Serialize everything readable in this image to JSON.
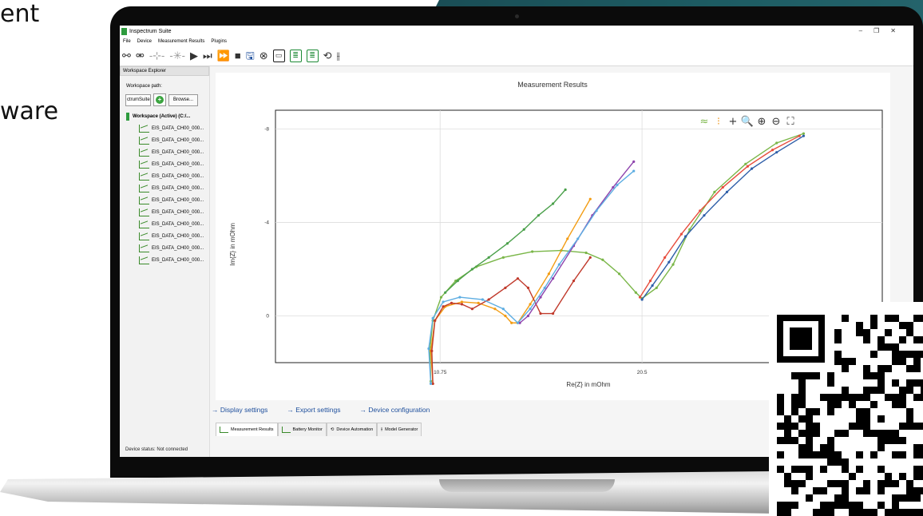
{
  "background": {
    "left_text_1": "ent",
    "left_text_2": "ware"
  },
  "app": {
    "title": "Inspectrum Suite",
    "window_controls": [
      "–",
      "❐",
      "✕"
    ],
    "menu": [
      "File",
      "Device",
      "Measurement Results",
      "Plugins"
    ]
  },
  "toolbar": {
    "icons": [
      "connect-icon",
      "disconnect-icon",
      "probe-icon",
      "probe-multi-icon",
      "play-icon",
      "skip-icon",
      "fast-forward-icon",
      "stop-icon",
      "save-icon",
      "cancel-icon",
      "device-icon",
      "sequence-icon",
      "sequence-edit-icon",
      "automation-icon",
      "circuit-icon"
    ]
  },
  "sidebar": {
    "tab_label": "Workspace Explorer",
    "path_label": "Workspace path:",
    "path_value": "ctrumSuite",
    "browse_label": "Browse...",
    "root_label": "Workspace (Active) (C:/...",
    "items": [
      "EIS_DATA_CH00_000...",
      "EIS_DATA_CH00_000...",
      "EIS_DATA_CH00_000...",
      "EIS_DATA_CH00_000...",
      "EIS_DATA_CH00_000...",
      "EIS_DATA_CH00_000...",
      "EIS_DATA_CH00_000...",
      "EIS_DATA_CH00_000...",
      "EIS_DATA_CH00_000...",
      "EIS_DATA_CH00_000...",
      "EIS_DATA_CH00_000...",
      "EIS_DATA_CH00_000..."
    ]
  },
  "links": [
    "→  Display settings",
    "→  Export settings",
    "→  Device configuration"
  ],
  "bottom_tabs": [
    "Measurement Results",
    "Battery Monitor",
    "Device Automation",
    "Model Generator"
  ],
  "status": {
    "label": "Device status:",
    "value": "Not connected"
  },
  "chart_data": {
    "type": "line",
    "title": "Measurement Results",
    "xlabel": "Re{Z} in mOhm",
    "ylabel": "Im{Z} in mOhm",
    "x_ticks": [
      10.75,
      20.5
    ],
    "y_ticks": [
      -8,
      -4,
      0
    ],
    "xlim": [
      2.8,
      32.1
    ],
    "ylim": [
      2.0,
      -8.8
    ],
    "y_inverted": true,
    "grid": true,
    "chart_tools": [
      "series-style-icon",
      "legend-icon",
      "crosshair-icon",
      "zoom-icon",
      "zoom-in-icon",
      "zoom-out-icon",
      "fit-icon"
    ],
    "series": [
      {
        "color": "#7ab648",
        "x": [
          10.3,
          10.25,
          10.4,
          10.8,
          11.5,
          12.5,
          13.8,
          15.2,
          16.6,
          17.8,
          18.6,
          19.4,
          20.2,
          20.5,
          21.2,
          22.0,
          22.8,
          24.0,
          25.5,
          27.0,
          28.3
        ],
        "y": [
          2.8,
          1.5,
          0.2,
          -0.8,
          -1.5,
          -2.1,
          -2.5,
          -2.75,
          -2.8,
          -2.7,
          -2.4,
          -1.8,
          -1.0,
          -0.75,
          -1.2,
          -2.2,
          -3.7,
          -5.3,
          -6.5,
          -7.4,
          -7.8
        ]
      },
      {
        "color": "#f39c12",
        "x": [
          10.4,
          10.3,
          10.5,
          11.0,
          11.8,
          12.6,
          13.4,
          13.9,
          14.2,
          14.5,
          15.1,
          16.0,
          16.9,
          18.0
        ],
        "y": [
          2.9,
          1.5,
          0.2,
          -0.4,
          -0.6,
          -0.55,
          -0.3,
          0.0,
          0.3,
          0.3,
          -0.5,
          -1.8,
          -3.3,
          -5.0
        ]
      },
      {
        "color": "#c0392b",
        "x": [
          10.4,
          10.35,
          10.5,
          10.9,
          11.3,
          11.8,
          12.3,
          13.1,
          13.9,
          14.5,
          15.0,
          15.6,
          16.2,
          17.2,
          18.0
        ],
        "y": [
          2.9,
          1.5,
          0.2,
          -0.4,
          -0.55,
          -0.5,
          -0.3,
          -0.7,
          -1.2,
          -1.6,
          -1.2,
          -0.1,
          -0.1,
          -1.5,
          -2.5
        ]
      },
      {
        "color": "#8e44ad",
        "x": [
          14.6,
          15.0,
          15.6,
          16.2,
          17.2,
          18.1,
          19.1,
          20.1
        ],
        "y": [
          0.3,
          0.0,
          -0.8,
          -1.6,
          -3.0,
          -4.3,
          -5.5,
          -6.6
        ]
      },
      {
        "color": "#5dade2",
        "x": [
          10.3,
          10.2,
          10.4,
          10.9,
          11.7,
          12.8,
          13.8,
          14.5,
          15.1,
          15.8,
          16.5,
          17.4,
          18.3,
          19.3,
          20.1
        ],
        "y": [
          2.9,
          1.4,
          0.1,
          -0.6,
          -0.8,
          -0.7,
          -0.3,
          0.3,
          -0.3,
          -1.2,
          -2.2,
          -3.3,
          -4.5,
          -5.6,
          -6.2
        ]
      },
      {
        "color": "#4aa04a",
        "x": [
          11.0,
          11.6,
          12.3,
          13.1,
          14.0,
          14.8,
          15.5,
          16.2,
          16.8
        ],
        "y": [
          -1.0,
          -1.5,
          -2.0,
          -2.5,
          -3.1,
          -3.7,
          -4.3,
          -4.8,
          -5.4
        ]
      },
      {
        "color": "#e74c3c",
        "x": [
          20.4,
          20.9,
          21.6,
          22.4,
          23.3,
          24.4,
          25.6,
          26.8,
          28.1
        ],
        "y": [
          -0.8,
          -1.5,
          -2.5,
          -3.5,
          -4.5,
          -5.5,
          -6.4,
          -7.1,
          -7.7
        ]
      },
      {
        "color": "#2e5ea8",
        "x": [
          20.5,
          21.0,
          21.8,
          22.6,
          23.5,
          24.6,
          25.8,
          27.0,
          28.3
        ],
        "y": [
          -0.7,
          -1.3,
          -2.3,
          -3.4,
          -4.3,
          -5.3,
          -6.3,
          -7.0,
          -7.7
        ]
      }
    ]
  }
}
